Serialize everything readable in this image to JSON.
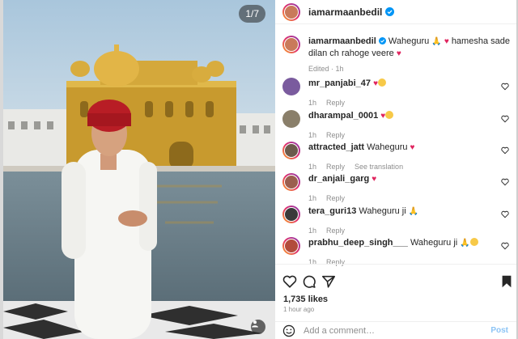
{
  "photo": {
    "counter": "1/7"
  },
  "header": {
    "username": "iamarmaanbedil"
  },
  "caption": {
    "username": "iamarmaanbedil",
    "text_1": "Waheguru",
    "text_2": "hamesha sade dilan ch rahoge veere",
    "meta": "Edited · 1h"
  },
  "comments": [
    {
      "username": "mr_panjabi_47",
      "text": "",
      "time": "1h",
      "reply": "Reply",
      "extra": ""
    },
    {
      "username": "dharampal_0001",
      "text": "",
      "time": "1h",
      "reply": "Reply",
      "extra": ""
    },
    {
      "username": "attracted_jatt",
      "text": "Waheguru",
      "time": "1h",
      "reply": "Reply",
      "extra": "See translation"
    },
    {
      "username": "dr_anjali_garg",
      "text": "",
      "time": "1h",
      "reply": "Reply",
      "extra": ""
    },
    {
      "username": "tera_guri13",
      "text": "Waheguru ji",
      "time": "1h",
      "reply": "Reply",
      "extra": ""
    },
    {
      "username": "prabhu_deep_singh___",
      "text": "Waheguru ji",
      "time": "1h",
      "reply": "Reply",
      "extra": ""
    }
  ],
  "actions": {
    "likes": "1,735 likes",
    "time_ago": "1 hour ago"
  },
  "add_comment": {
    "placeholder": "Add a comment…",
    "post_label": "Post"
  },
  "colors": {
    "heart": "#e0245e",
    "link_blue": "#0095f6",
    "verified": "#0095f6"
  }
}
